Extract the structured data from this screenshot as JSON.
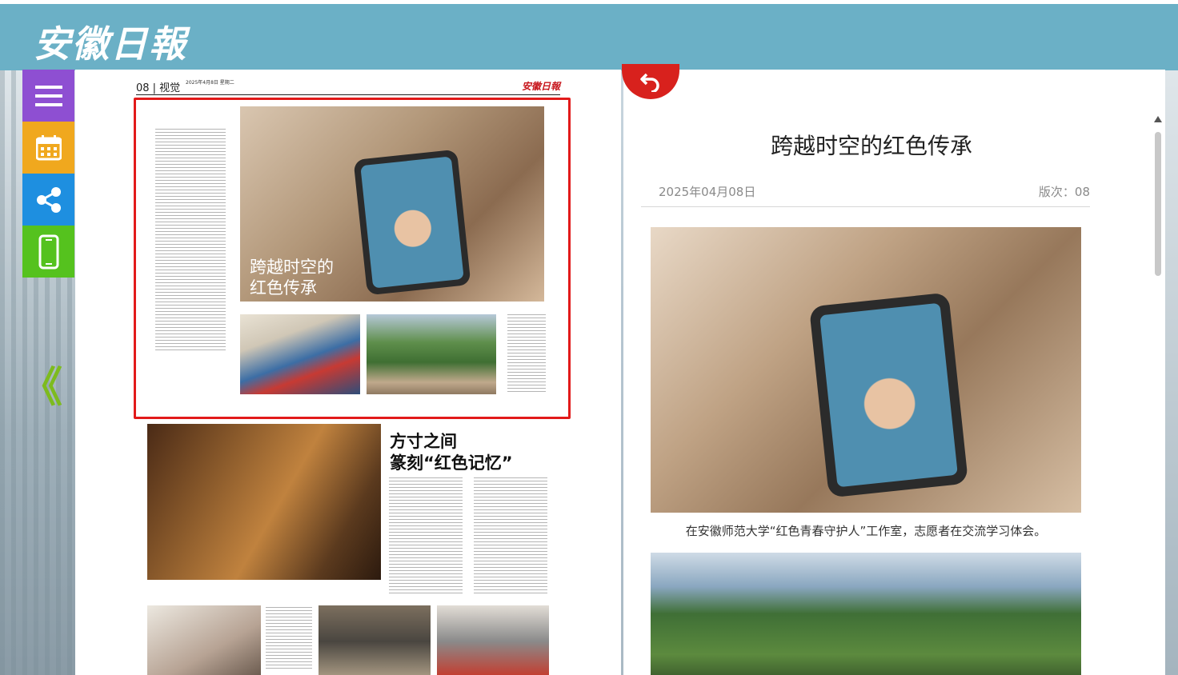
{
  "header": {
    "logo_text": "安徽日報"
  },
  "toolbar": {
    "items": [
      {
        "name": "menu",
        "icon": "hamburger-icon"
      },
      {
        "name": "calendar",
        "icon": "calendar-icon"
      },
      {
        "name": "share",
        "icon": "share-icon"
      },
      {
        "name": "mobile",
        "icon": "mobile-icon"
      }
    ],
    "prev_label": "《"
  },
  "newspaper": {
    "page_tag": "08 | 视觉",
    "page_date": "2025年4月8日 星期二",
    "mini_logo": "安徽日報",
    "highlight_title_line1": "跨越时空的",
    "highlight_title_line2": "红色传承",
    "lower_title_line1": "方寸之间",
    "lower_title_line2": "篆刻“红色记忆”"
  },
  "article": {
    "title": "跨越时空的红色传承",
    "date": "2025年04月08日",
    "page_label": "版次：08",
    "caption": "在安徽师范大学“红色青春守护人”工作室，志愿者在交流学习体会。"
  },
  "colors": {
    "header_bg": "#6bb0c6",
    "highlight_border": "#e21a1a",
    "menu_btn": "#8e4fd2",
    "calendar_btn": "#f0a81e",
    "share_btn": "#1e8fe0",
    "mobile_btn": "#55c21e",
    "return_btn": "#d8211d"
  }
}
